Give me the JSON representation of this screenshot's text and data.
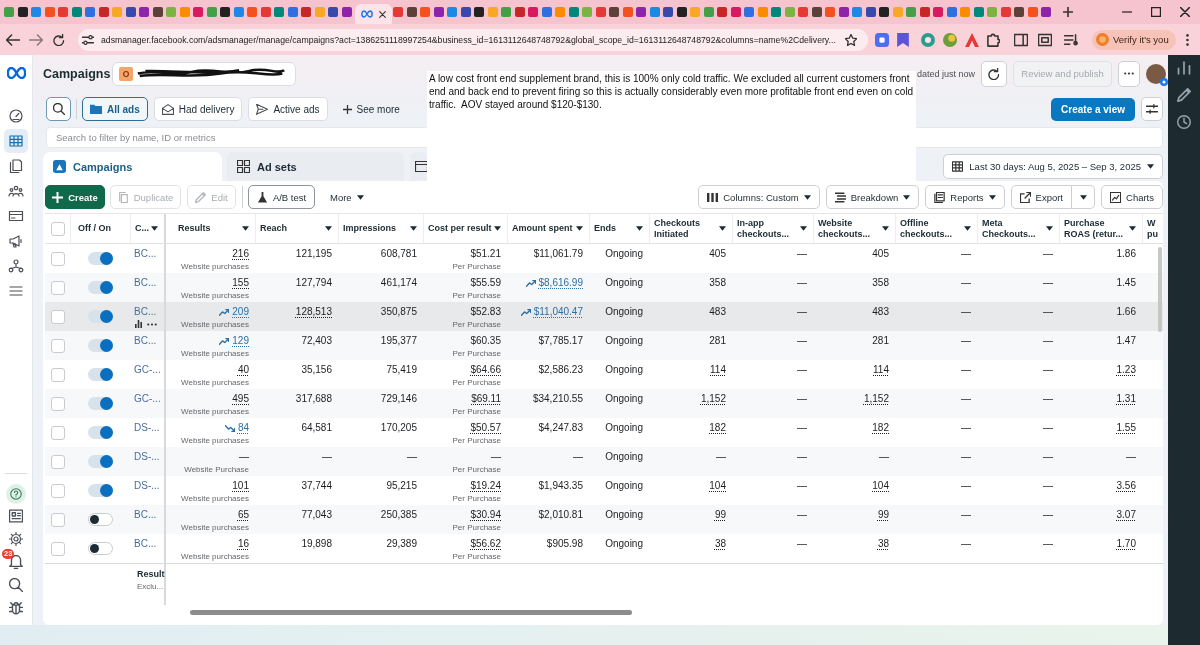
{
  "browser": {
    "url": "adsmanager.facebook.com/adsmanager/manage/campaigns?act=1386251118997254&business_id=1613112648748792&global_scope_id=1613112648748792&columns=name%2Cdelivery...",
    "profile_button": "Verify it's you"
  },
  "sidebar": {
    "items": [
      {
        "selected": false
      },
      {
        "selected": true
      },
      {
        "selected": false
      },
      {
        "selected": false
      },
      {
        "selected": false
      },
      {
        "selected": false
      },
      {
        "selected": false
      },
      {
        "selected": false
      }
    ],
    "notification_count": "23"
  },
  "header": {
    "title": "Campaigns",
    "account_initial": "O",
    "updated": "dated just now",
    "publish_button": "Review and publish",
    "publish_disabled": true
  },
  "note": {
    "text": "A low cost front end supplement brand, this is 100% only cold traffic. We excluded all current customers front end and back end to prevent firing so this is actually considerably even more profitable front end even on cold traffic.  AOV stayed around $120-$130."
  },
  "filters": {
    "chips": [
      {
        "label": "All ads",
        "selected": true
      },
      {
        "label": "Had delivery",
        "selected": false
      },
      {
        "label": "Active ads",
        "selected": false
      }
    ],
    "see_more": "See more",
    "create_view": "Create a view"
  },
  "search": {
    "placeholder": "Search to filter by name, ID or metrics"
  },
  "level_tabs": [
    {
      "label": "Campaigns",
      "selected": true
    },
    {
      "label": "Ad sets",
      "selected": false
    },
    {
      "selected": false
    }
  ],
  "date_range": "Last 30 days: Aug 5, 2025 – Sep 3, 2025",
  "toolbar": {
    "create": "Create",
    "duplicate": {
      "label": "Duplicate",
      "disabled": true
    },
    "edit": {
      "label": "Edit",
      "disabled": true
    },
    "ab_test": "A/B test",
    "more": "More",
    "columns": "Columns: Custom",
    "breakdown": "Breakdown",
    "reports": "Reports",
    "export": "Export",
    "charts": "Charts"
  },
  "table": {
    "header_checked": false,
    "toggle_header": "Off / On",
    "name_header": {
      "label": "C...",
      "dropdown": true
    },
    "columns": [
      {
        "label": "Results",
        "dropdown": true
      },
      {
        "label": "Reach",
        "dropdown": true
      },
      {
        "label": "Impressions",
        "dropdown": true
      },
      {
        "label": "Cost per result",
        "dropdown": true
      },
      {
        "label": "Amount spent",
        "dropdown": true
      },
      {
        "label": "Ends",
        "dropdown": true
      },
      {
        "label": "Checkouts Initiated",
        "dropdown": true
      },
      {
        "label": "In-app checkouts...",
        "dropdown": true
      },
      {
        "label": "Website checkouts...",
        "dropdown": true
      },
      {
        "label": "Offline checkouts...",
        "dropdown": true
      },
      {
        "label": "Meta Checkouts...",
        "dropdown": true
      },
      {
        "label": "Purchase ROAS (retur...",
        "dropdown": true
      },
      {
        "label": "W pu",
        "dropdown": false
      }
    ],
    "rows": [
      {
        "checked": false,
        "on": true,
        "hovered": false,
        "name": "BC...",
        "cells": [
          {
            "text": "216",
            "sub": "Website purchases",
            "kind": "dotted"
          },
          {
            "text": "121,195",
            "kind": "plain"
          },
          {
            "text": "608,781",
            "kind": "plain"
          },
          {
            "text": "$51.21",
            "sub": "Per Purchase",
            "kind": "plain"
          },
          {
            "text": "$11,061.79",
            "kind": "plain"
          },
          {
            "text": "Ongoing",
            "kind": "plain"
          },
          {
            "text": "405",
            "kind": "plain"
          },
          {
            "text": "—",
            "kind": "plain"
          },
          {
            "text": "405",
            "kind": "plain"
          },
          {
            "text": "—",
            "kind": "plain"
          },
          {
            "text": "—",
            "kind": "plain"
          },
          {
            "text": "1.86",
            "kind": "plain"
          }
        ]
      },
      {
        "checked": false,
        "on": true,
        "hovered": false,
        "name": "BC...",
        "cells": [
          {
            "text": "155",
            "sub": "Website purchases",
            "kind": "dotted"
          },
          {
            "text": "127,794",
            "kind": "plain"
          },
          {
            "text": "461,174",
            "kind": "plain"
          },
          {
            "text": "$55.59",
            "sub": "Per Purchase",
            "kind": "plain"
          },
          {
            "text": "$8,616.99",
            "kind": "trend_up"
          },
          {
            "text": "Ongoing",
            "kind": "plain"
          },
          {
            "text": "358",
            "kind": "plain"
          },
          {
            "text": "—",
            "kind": "plain"
          },
          {
            "text": "358",
            "kind": "plain"
          },
          {
            "text": "—",
            "kind": "plain"
          },
          {
            "text": "—",
            "kind": "plain"
          },
          {
            "text": "1.45",
            "kind": "plain"
          }
        ]
      },
      {
        "checked": false,
        "on": true,
        "hovered": true,
        "name": "BC...",
        "cells": [
          {
            "text": "209",
            "sub": "Website purchases",
            "kind": "trend_up"
          },
          {
            "text": "128,513",
            "kind": "dotted"
          },
          {
            "text": "350,875",
            "kind": "plain"
          },
          {
            "text": "$52.83",
            "sub": "Per Purchase",
            "kind": "plain"
          },
          {
            "text": "$11,040.47",
            "kind": "trend_up"
          },
          {
            "text": "Ongoing",
            "kind": "plain"
          },
          {
            "text": "483",
            "kind": "plain"
          },
          {
            "text": "—",
            "kind": "plain"
          },
          {
            "text": "483",
            "kind": "plain"
          },
          {
            "text": "—",
            "kind": "plain"
          },
          {
            "text": "—",
            "kind": "plain"
          },
          {
            "text": "1.66",
            "kind": "plain"
          }
        ]
      },
      {
        "checked": false,
        "on": true,
        "hovered": false,
        "name": "BC...",
        "cells": [
          {
            "text": "129",
            "sub": "Website purchases",
            "kind": "trend_up"
          },
          {
            "text": "72,403",
            "kind": "plain"
          },
          {
            "text": "195,377",
            "kind": "plain"
          },
          {
            "text": "$60.35",
            "sub": "Per Purchase",
            "kind": "plain"
          },
          {
            "text": "$7,785.17",
            "kind": "plain"
          },
          {
            "text": "Ongoing",
            "kind": "plain"
          },
          {
            "text": "281",
            "kind": "plain"
          },
          {
            "text": "—",
            "kind": "plain"
          },
          {
            "text": "281",
            "kind": "plain"
          },
          {
            "text": "—",
            "kind": "plain"
          },
          {
            "text": "—",
            "kind": "plain"
          },
          {
            "text": "1.47",
            "kind": "plain"
          }
        ]
      },
      {
        "checked": false,
        "on": true,
        "hovered": false,
        "name": "GC-...",
        "cells": [
          {
            "text": "40",
            "sub": "Website purchases",
            "kind": "dotted"
          },
          {
            "text": "35,156",
            "kind": "plain"
          },
          {
            "text": "75,419",
            "kind": "plain"
          },
          {
            "text": "$64.66",
            "sub": "Per Purchase",
            "kind": "dotted"
          },
          {
            "text": "$2,586.23",
            "kind": "plain"
          },
          {
            "text": "Ongoing",
            "kind": "plain"
          },
          {
            "text": "114",
            "kind": "dotted"
          },
          {
            "text": "—",
            "kind": "plain"
          },
          {
            "text": "114",
            "kind": "dotted"
          },
          {
            "text": "—",
            "kind": "plain"
          },
          {
            "text": "—",
            "kind": "plain"
          },
          {
            "text": "1.23",
            "kind": "dotted"
          }
        ]
      },
      {
        "checked": false,
        "on": true,
        "hovered": false,
        "name": "GC-...",
        "cells": [
          {
            "text": "495",
            "sub": "Website purchases",
            "kind": "dotted"
          },
          {
            "text": "317,688",
            "kind": "plain"
          },
          {
            "text": "729,146",
            "kind": "plain"
          },
          {
            "text": "$69.11",
            "sub": "Per Purchase",
            "kind": "dotted"
          },
          {
            "text": "$34,210.55",
            "kind": "plain"
          },
          {
            "text": "Ongoing",
            "kind": "plain"
          },
          {
            "text": "1,152",
            "kind": "dotted"
          },
          {
            "text": "—",
            "kind": "plain"
          },
          {
            "text": "1,152",
            "kind": "dotted"
          },
          {
            "text": "—",
            "kind": "plain"
          },
          {
            "text": "—",
            "kind": "plain"
          },
          {
            "text": "1.31",
            "kind": "dotted"
          }
        ]
      },
      {
        "checked": false,
        "on": true,
        "hovered": false,
        "name": "DS-...",
        "cells": [
          {
            "text": "84",
            "sub": "Website purchases",
            "kind": "trend_down"
          },
          {
            "text": "64,581",
            "kind": "plain"
          },
          {
            "text": "170,205",
            "kind": "plain"
          },
          {
            "text": "$50.57",
            "sub": "Per Purchase",
            "kind": "dotted"
          },
          {
            "text": "$4,247.83",
            "kind": "plain"
          },
          {
            "text": "Ongoing",
            "kind": "plain"
          },
          {
            "text": "182",
            "kind": "dotted"
          },
          {
            "text": "—",
            "kind": "plain"
          },
          {
            "text": "182",
            "kind": "dotted"
          },
          {
            "text": "—",
            "kind": "plain"
          },
          {
            "text": "—",
            "kind": "plain"
          },
          {
            "text": "1.55",
            "kind": "dotted"
          }
        ]
      },
      {
        "checked": false,
        "on": true,
        "hovered": false,
        "name": "DS-...",
        "cells": [
          {
            "text": "—",
            "sub": "Website Purchase",
            "kind": "plain"
          },
          {
            "text": "—",
            "kind": "plain"
          },
          {
            "text": "—",
            "kind": "plain"
          },
          {
            "text": "—",
            "sub": "Per Purchase",
            "kind": "plain"
          },
          {
            "text": "—",
            "kind": "plain"
          },
          {
            "text": "Ongoing",
            "kind": "plain"
          },
          {
            "text": "—",
            "kind": "plain"
          },
          {
            "text": "—",
            "kind": "plain"
          },
          {
            "text": "—",
            "kind": "plain"
          },
          {
            "text": "—",
            "kind": "plain"
          },
          {
            "text": "—",
            "kind": "plain"
          },
          {
            "text": "—",
            "kind": "plain"
          }
        ]
      },
      {
        "checked": false,
        "on": true,
        "hovered": false,
        "name": "DS-...",
        "cells": [
          {
            "text": "101",
            "sub": "Website purchases",
            "kind": "dotted"
          },
          {
            "text": "37,744",
            "kind": "plain"
          },
          {
            "text": "95,215",
            "kind": "plain"
          },
          {
            "text": "$19.24",
            "sub": "Per Purchase",
            "kind": "dotted"
          },
          {
            "text": "$1,943.35",
            "kind": "plain"
          },
          {
            "text": "Ongoing",
            "kind": "plain"
          },
          {
            "text": "104",
            "kind": "dotted"
          },
          {
            "text": "—",
            "kind": "plain"
          },
          {
            "text": "104",
            "kind": "dotted"
          },
          {
            "text": "—",
            "kind": "plain"
          },
          {
            "text": "—",
            "kind": "plain"
          },
          {
            "text": "3.56",
            "kind": "dotted"
          }
        ]
      },
      {
        "checked": false,
        "on": false,
        "hovered": false,
        "name": "BC...",
        "cells": [
          {
            "text": "65",
            "sub": "Website purchases",
            "kind": "dotted"
          },
          {
            "text": "77,043",
            "kind": "plain"
          },
          {
            "text": "250,385",
            "kind": "plain"
          },
          {
            "text": "$30.94",
            "sub": "Per Purchase",
            "kind": "dotted"
          },
          {
            "text": "$2,010.81",
            "kind": "plain"
          },
          {
            "text": "Ongoing",
            "kind": "plain"
          },
          {
            "text": "99",
            "kind": "dotted"
          },
          {
            "text": "—",
            "kind": "plain"
          },
          {
            "text": "99",
            "kind": "dotted"
          },
          {
            "text": "—",
            "kind": "plain"
          },
          {
            "text": "—",
            "kind": "plain"
          },
          {
            "text": "3.07",
            "kind": "dotted"
          }
        ]
      },
      {
        "checked": false,
        "on": false,
        "hovered": false,
        "name": "BC...",
        "cells": [
          {
            "text": "16",
            "sub": "Website purchases",
            "kind": "dotted"
          },
          {
            "text": "19,898",
            "kind": "plain"
          },
          {
            "text": "29,389",
            "kind": "plain"
          },
          {
            "text": "$56.62",
            "sub": "Per Purchase",
            "kind": "dotted"
          },
          {
            "text": "$905.98",
            "kind": "plain"
          },
          {
            "text": "Ongoing",
            "kind": "plain"
          },
          {
            "text": "38",
            "kind": "dotted"
          },
          {
            "text": "—",
            "kind": "plain"
          },
          {
            "text": "38",
            "kind": "dotted"
          },
          {
            "text": "—",
            "kind": "plain"
          },
          {
            "text": "—",
            "kind": "plain"
          },
          {
            "text": "1.70",
            "kind": "dotted"
          }
        ]
      }
    ],
    "footer": {
      "title": "Result",
      "subtitle": "Exclu..."
    }
  }
}
